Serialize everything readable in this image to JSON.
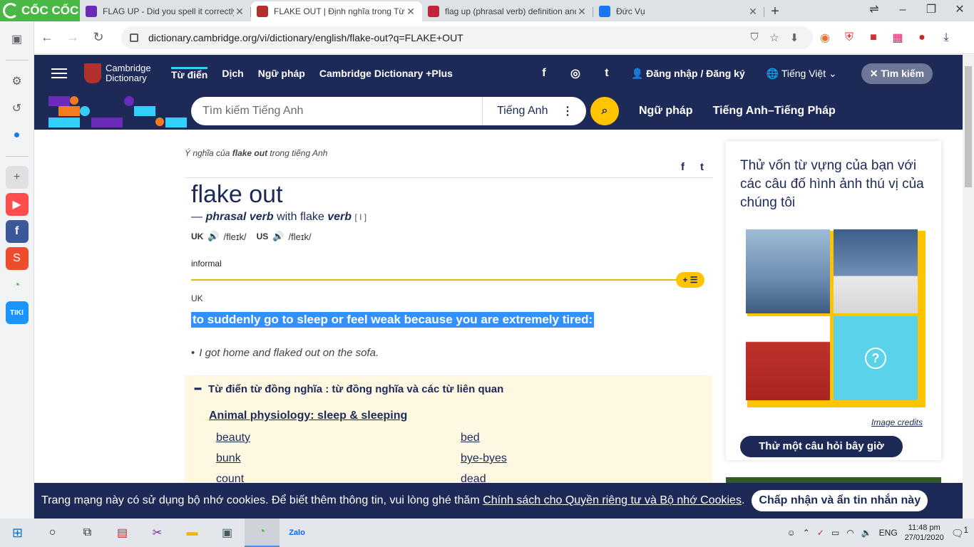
{
  "browser": {
    "brand": "CỐC CỐC",
    "tabs": [
      {
        "title": "FLAG UP - Did you spell it correctly",
        "active": false,
        "color": "#6a2bb8"
      },
      {
        "title": "FLAKE OUT | Định nghĩa trong Từ điển",
        "active": true,
        "color": "#b3302c"
      },
      {
        "title": "flag up (phrasal verb) definition and",
        "active": false,
        "color": "#c0243c"
      },
      {
        "title": "Đức Vụ",
        "active": false,
        "color": "#1877f2"
      }
    ],
    "url": "dictionary.cambridge.org/vi/dictionary/english/flake-out?q=FLAKE+OUT"
  },
  "header": {
    "logo_line1": "Cambridge",
    "logo_line2": "Dictionary",
    "nav": [
      "Từ điển",
      "Dịch",
      "Ngữ pháp",
      "Cambridge Dictionary +Plus"
    ],
    "social": [
      "f",
      "◎",
      "t"
    ],
    "login": "Đăng nhập / Đăng ký",
    "language": "Tiếng Việt",
    "search_button": "Tìm kiếm"
  },
  "search": {
    "placeholder": "Tìm kiếm Tiếng Anh",
    "dropdown": "Tiếng Anh",
    "links": [
      "Ngữ pháp",
      "Tiếng Anh–Tiếng Pháp"
    ]
  },
  "entry": {
    "crumb_prefix": "Ý nghĩa của",
    "crumb_word": "flake out",
    "crumb_suffix": "trong tiếng Anh",
    "headword": "flake out",
    "pos_dash": "—",
    "pos": "phrasal verb",
    "pos_with": "with flake",
    "pos_verb": "verb",
    "grammar": "[ I ]",
    "uk_label": "UK",
    "uk_ipa": "/fleɪk/",
    "us_label": "US",
    "us_ipa": "/fleɪk/",
    "register": "informal",
    "plus_label": "+ ☰",
    "region": "UK",
    "definition": "to suddenly go to sleep or feel weak because you are extremely tired:",
    "example": "I got home and flaked out on the sofa."
  },
  "synonyms": {
    "heading": "Từ điển từ đồng nghĩa : từ đồng nghĩa và các từ liên quan",
    "topic": "Animal physiology: sleep & sleeping",
    "left": [
      "beauty",
      "bunk",
      "count"
    ],
    "right": [
      "bed",
      "bye-byes",
      "dead"
    ]
  },
  "quiz": {
    "title": "Thử vốn từ vựng của bạn với các câu đố hình ảnh thú vị của chúng tôi",
    "credits": "Image credits",
    "button": "Thử một câu hỏi bây giờ",
    "question_mark": "?"
  },
  "cookie": {
    "text": "Trang mạng này có sử dụng bộ nhớ cookies. Để biết thêm thông tin, vui lòng ghé thăm",
    "link": "Chính sách cho Quyền riêng tư và Bộ nhớ Cookies",
    "end": ".",
    "button": "Chấp nhận và ẩn tin nhắn này"
  },
  "taskbar": {
    "lang": "ENG",
    "time": "11:48 pm",
    "date": "27/01/2020",
    "notif": "1"
  },
  "colors": {
    "cambridge_navy": "#1d2a57",
    "accent_yellow": "#fec400",
    "selection": "#3390ff",
    "coccoc_green": "#4ab846"
  }
}
